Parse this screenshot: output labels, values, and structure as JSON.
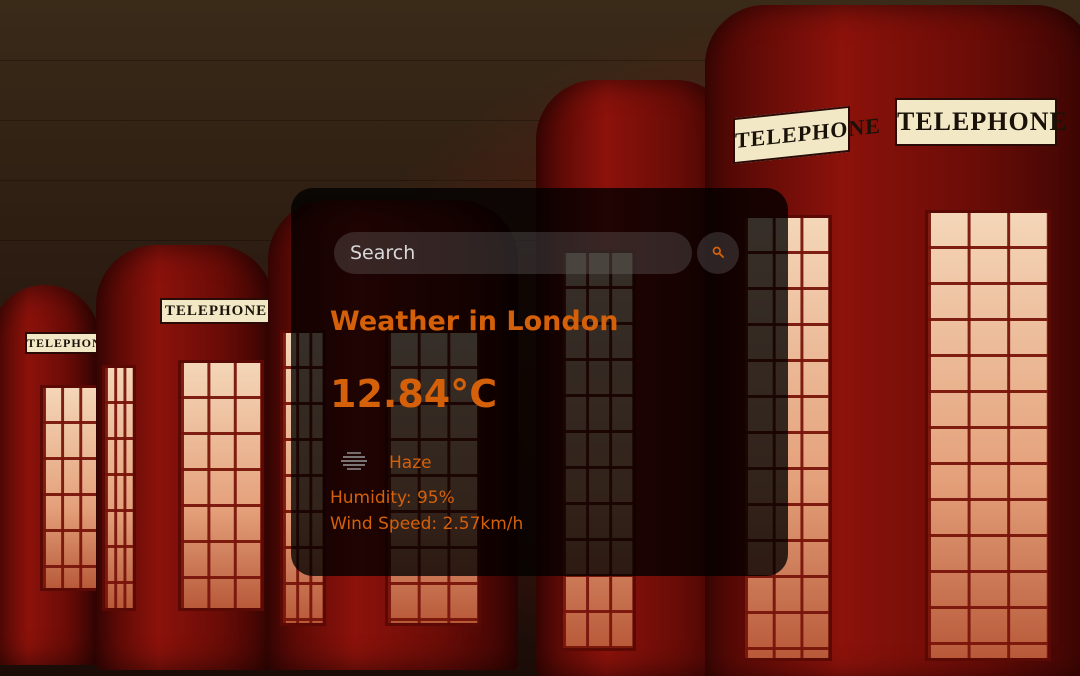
{
  "search": {
    "placeholder": "Search",
    "button_icon": "search-icon"
  },
  "weather": {
    "title": "Weather in London",
    "temperature": "12.84°C",
    "condition_icon": "haze-icon",
    "condition": "Haze",
    "humidity": "Humidity: 95%",
    "wind_speed": "Wind Speed: 2.57km/h"
  },
  "background": {
    "sign_text": "TELEPHONE"
  },
  "colors": {
    "accent": "#d4600a",
    "card": "#000000",
    "booth_red": "#8c120b"
  }
}
